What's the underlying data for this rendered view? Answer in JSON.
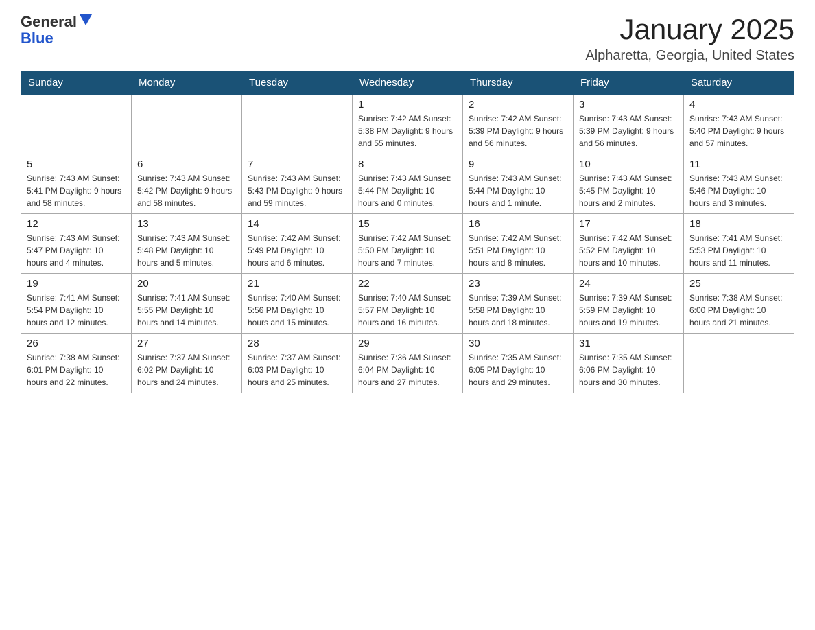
{
  "header": {
    "logo_general": "General",
    "logo_blue": "Blue",
    "title": "January 2025",
    "subtitle": "Alpharetta, Georgia, United States"
  },
  "days_of_week": [
    "Sunday",
    "Monday",
    "Tuesday",
    "Wednesday",
    "Thursday",
    "Friday",
    "Saturday"
  ],
  "weeks": [
    [
      {
        "day": "",
        "info": ""
      },
      {
        "day": "",
        "info": ""
      },
      {
        "day": "",
        "info": ""
      },
      {
        "day": "1",
        "info": "Sunrise: 7:42 AM\nSunset: 5:38 PM\nDaylight: 9 hours\nand 55 minutes."
      },
      {
        "day": "2",
        "info": "Sunrise: 7:42 AM\nSunset: 5:39 PM\nDaylight: 9 hours\nand 56 minutes."
      },
      {
        "day": "3",
        "info": "Sunrise: 7:43 AM\nSunset: 5:39 PM\nDaylight: 9 hours\nand 56 minutes."
      },
      {
        "day": "4",
        "info": "Sunrise: 7:43 AM\nSunset: 5:40 PM\nDaylight: 9 hours\nand 57 minutes."
      }
    ],
    [
      {
        "day": "5",
        "info": "Sunrise: 7:43 AM\nSunset: 5:41 PM\nDaylight: 9 hours\nand 58 minutes."
      },
      {
        "day": "6",
        "info": "Sunrise: 7:43 AM\nSunset: 5:42 PM\nDaylight: 9 hours\nand 58 minutes."
      },
      {
        "day": "7",
        "info": "Sunrise: 7:43 AM\nSunset: 5:43 PM\nDaylight: 9 hours\nand 59 minutes."
      },
      {
        "day": "8",
        "info": "Sunrise: 7:43 AM\nSunset: 5:44 PM\nDaylight: 10 hours\nand 0 minutes."
      },
      {
        "day": "9",
        "info": "Sunrise: 7:43 AM\nSunset: 5:44 PM\nDaylight: 10 hours\nand 1 minute."
      },
      {
        "day": "10",
        "info": "Sunrise: 7:43 AM\nSunset: 5:45 PM\nDaylight: 10 hours\nand 2 minutes."
      },
      {
        "day": "11",
        "info": "Sunrise: 7:43 AM\nSunset: 5:46 PM\nDaylight: 10 hours\nand 3 minutes."
      }
    ],
    [
      {
        "day": "12",
        "info": "Sunrise: 7:43 AM\nSunset: 5:47 PM\nDaylight: 10 hours\nand 4 minutes."
      },
      {
        "day": "13",
        "info": "Sunrise: 7:43 AM\nSunset: 5:48 PM\nDaylight: 10 hours\nand 5 minutes."
      },
      {
        "day": "14",
        "info": "Sunrise: 7:42 AM\nSunset: 5:49 PM\nDaylight: 10 hours\nand 6 minutes."
      },
      {
        "day": "15",
        "info": "Sunrise: 7:42 AM\nSunset: 5:50 PM\nDaylight: 10 hours\nand 7 minutes."
      },
      {
        "day": "16",
        "info": "Sunrise: 7:42 AM\nSunset: 5:51 PM\nDaylight: 10 hours\nand 8 minutes."
      },
      {
        "day": "17",
        "info": "Sunrise: 7:42 AM\nSunset: 5:52 PM\nDaylight: 10 hours\nand 10 minutes."
      },
      {
        "day": "18",
        "info": "Sunrise: 7:41 AM\nSunset: 5:53 PM\nDaylight: 10 hours\nand 11 minutes."
      }
    ],
    [
      {
        "day": "19",
        "info": "Sunrise: 7:41 AM\nSunset: 5:54 PM\nDaylight: 10 hours\nand 12 minutes."
      },
      {
        "day": "20",
        "info": "Sunrise: 7:41 AM\nSunset: 5:55 PM\nDaylight: 10 hours\nand 14 minutes."
      },
      {
        "day": "21",
        "info": "Sunrise: 7:40 AM\nSunset: 5:56 PM\nDaylight: 10 hours\nand 15 minutes."
      },
      {
        "day": "22",
        "info": "Sunrise: 7:40 AM\nSunset: 5:57 PM\nDaylight: 10 hours\nand 16 minutes."
      },
      {
        "day": "23",
        "info": "Sunrise: 7:39 AM\nSunset: 5:58 PM\nDaylight: 10 hours\nand 18 minutes."
      },
      {
        "day": "24",
        "info": "Sunrise: 7:39 AM\nSunset: 5:59 PM\nDaylight: 10 hours\nand 19 minutes."
      },
      {
        "day": "25",
        "info": "Sunrise: 7:38 AM\nSunset: 6:00 PM\nDaylight: 10 hours\nand 21 minutes."
      }
    ],
    [
      {
        "day": "26",
        "info": "Sunrise: 7:38 AM\nSunset: 6:01 PM\nDaylight: 10 hours\nand 22 minutes."
      },
      {
        "day": "27",
        "info": "Sunrise: 7:37 AM\nSunset: 6:02 PM\nDaylight: 10 hours\nand 24 minutes."
      },
      {
        "day": "28",
        "info": "Sunrise: 7:37 AM\nSunset: 6:03 PM\nDaylight: 10 hours\nand 25 minutes."
      },
      {
        "day": "29",
        "info": "Sunrise: 7:36 AM\nSunset: 6:04 PM\nDaylight: 10 hours\nand 27 minutes."
      },
      {
        "day": "30",
        "info": "Sunrise: 7:35 AM\nSunset: 6:05 PM\nDaylight: 10 hours\nand 29 minutes."
      },
      {
        "day": "31",
        "info": "Sunrise: 7:35 AM\nSunset: 6:06 PM\nDaylight: 10 hours\nand 30 minutes."
      },
      {
        "day": "",
        "info": ""
      }
    ]
  ]
}
